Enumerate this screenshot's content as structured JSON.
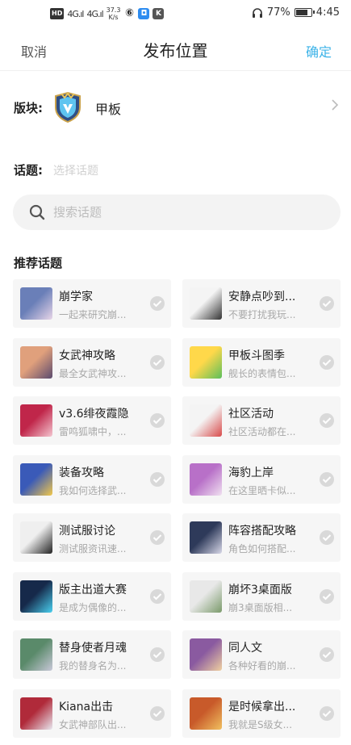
{
  "status": {
    "network_badge": "HD",
    "sig1": "4G",
    "sig2": "4G",
    "speed_value": "37.3",
    "speed_unit": "K/s",
    "headphones_icon": "headphones-icon",
    "battery_pct": 77,
    "battery_text": "77%",
    "time": "4:45"
  },
  "nav": {
    "cancel": "取消",
    "title": "发布位置",
    "confirm": "确定",
    "accent": "#3cb3e8"
  },
  "board": {
    "label": "版块:",
    "name": "甲板",
    "icon": "shield-emblem-icon"
  },
  "topic": {
    "label": "话题:",
    "placeholder": "选择话题"
  },
  "search": {
    "placeholder": "搜索话题",
    "icon": "search-icon"
  },
  "recommended": {
    "title": "推荐话题",
    "items": [
      {
        "title": "崩学家",
        "desc": "一起来研究崩...",
        "c1": "#6a7fb8",
        "c2": "#e8d6e8"
      },
      {
        "title": "安静点吵到...",
        "desc": "不要打扰我玩...",
        "c1": "#f4f4f4",
        "c2": "#333333"
      },
      {
        "title": "女武神攻略",
        "desc": "最全女武神攻...",
        "c1": "#e0a07c",
        "c2": "#5b4a6e"
      },
      {
        "title": "甲板斗图季",
        "desc": "舰长的表情包...",
        "c1": "#ffd84a",
        "c2": "#5bbf5b"
      },
      {
        "title": "v3.6绯夜霞隐",
        "desc": "雷鸣狐啸中，...",
        "c1": "#c0264a",
        "c2": "#f4c6d0"
      },
      {
        "title": "社区活动",
        "desc": "社区活动都在...",
        "c1": "#f4f4f4",
        "c2": "#d84a4a"
      },
      {
        "title": "装备攻略",
        "desc": "我如何选择武...",
        "c1": "#3a5ab8",
        "c2": "#f2c84a"
      },
      {
        "title": "海豹上岸",
        "desc": "在这里晒卡似...",
        "c1": "#b870c8",
        "c2": "#f0e0f0"
      },
      {
        "title": "测试服讨论",
        "desc": "测试服资讯速...",
        "c1": "#efefef",
        "c2": "#222222"
      },
      {
        "title": "阵容搭配攻略",
        "desc": "角色如何搭配...",
        "c1": "#2e3a5a",
        "c2": "#d8d8e8"
      },
      {
        "title": "版主出道大赛",
        "desc": "是成为偶像的...",
        "c1": "#16294a",
        "c2": "#4ad0f0"
      },
      {
        "title": "崩坏3桌面版",
        "desc": "崩3桌面版相...",
        "c1": "#e8e8e8",
        "c2": "#7a9a6a"
      },
      {
        "title": "替身使者月魂",
        "desc": "我的替身名为...",
        "c1": "#5a8a6a",
        "c2": "#c8c8d8"
      },
      {
        "title": "同人文",
        "desc": "各种好看的崩...",
        "c1": "#8a5aa0",
        "c2": "#f0d0a0"
      },
      {
        "title": "Kiana出击",
        "desc": "女武神部队出...",
        "c1": "#b02a3a",
        "c2": "#e8e8f0"
      },
      {
        "title": "是时候拿出...",
        "desc": "我就是S级女...",
        "c1": "#c85a2a",
        "c2": "#f0c060"
      }
    ]
  }
}
